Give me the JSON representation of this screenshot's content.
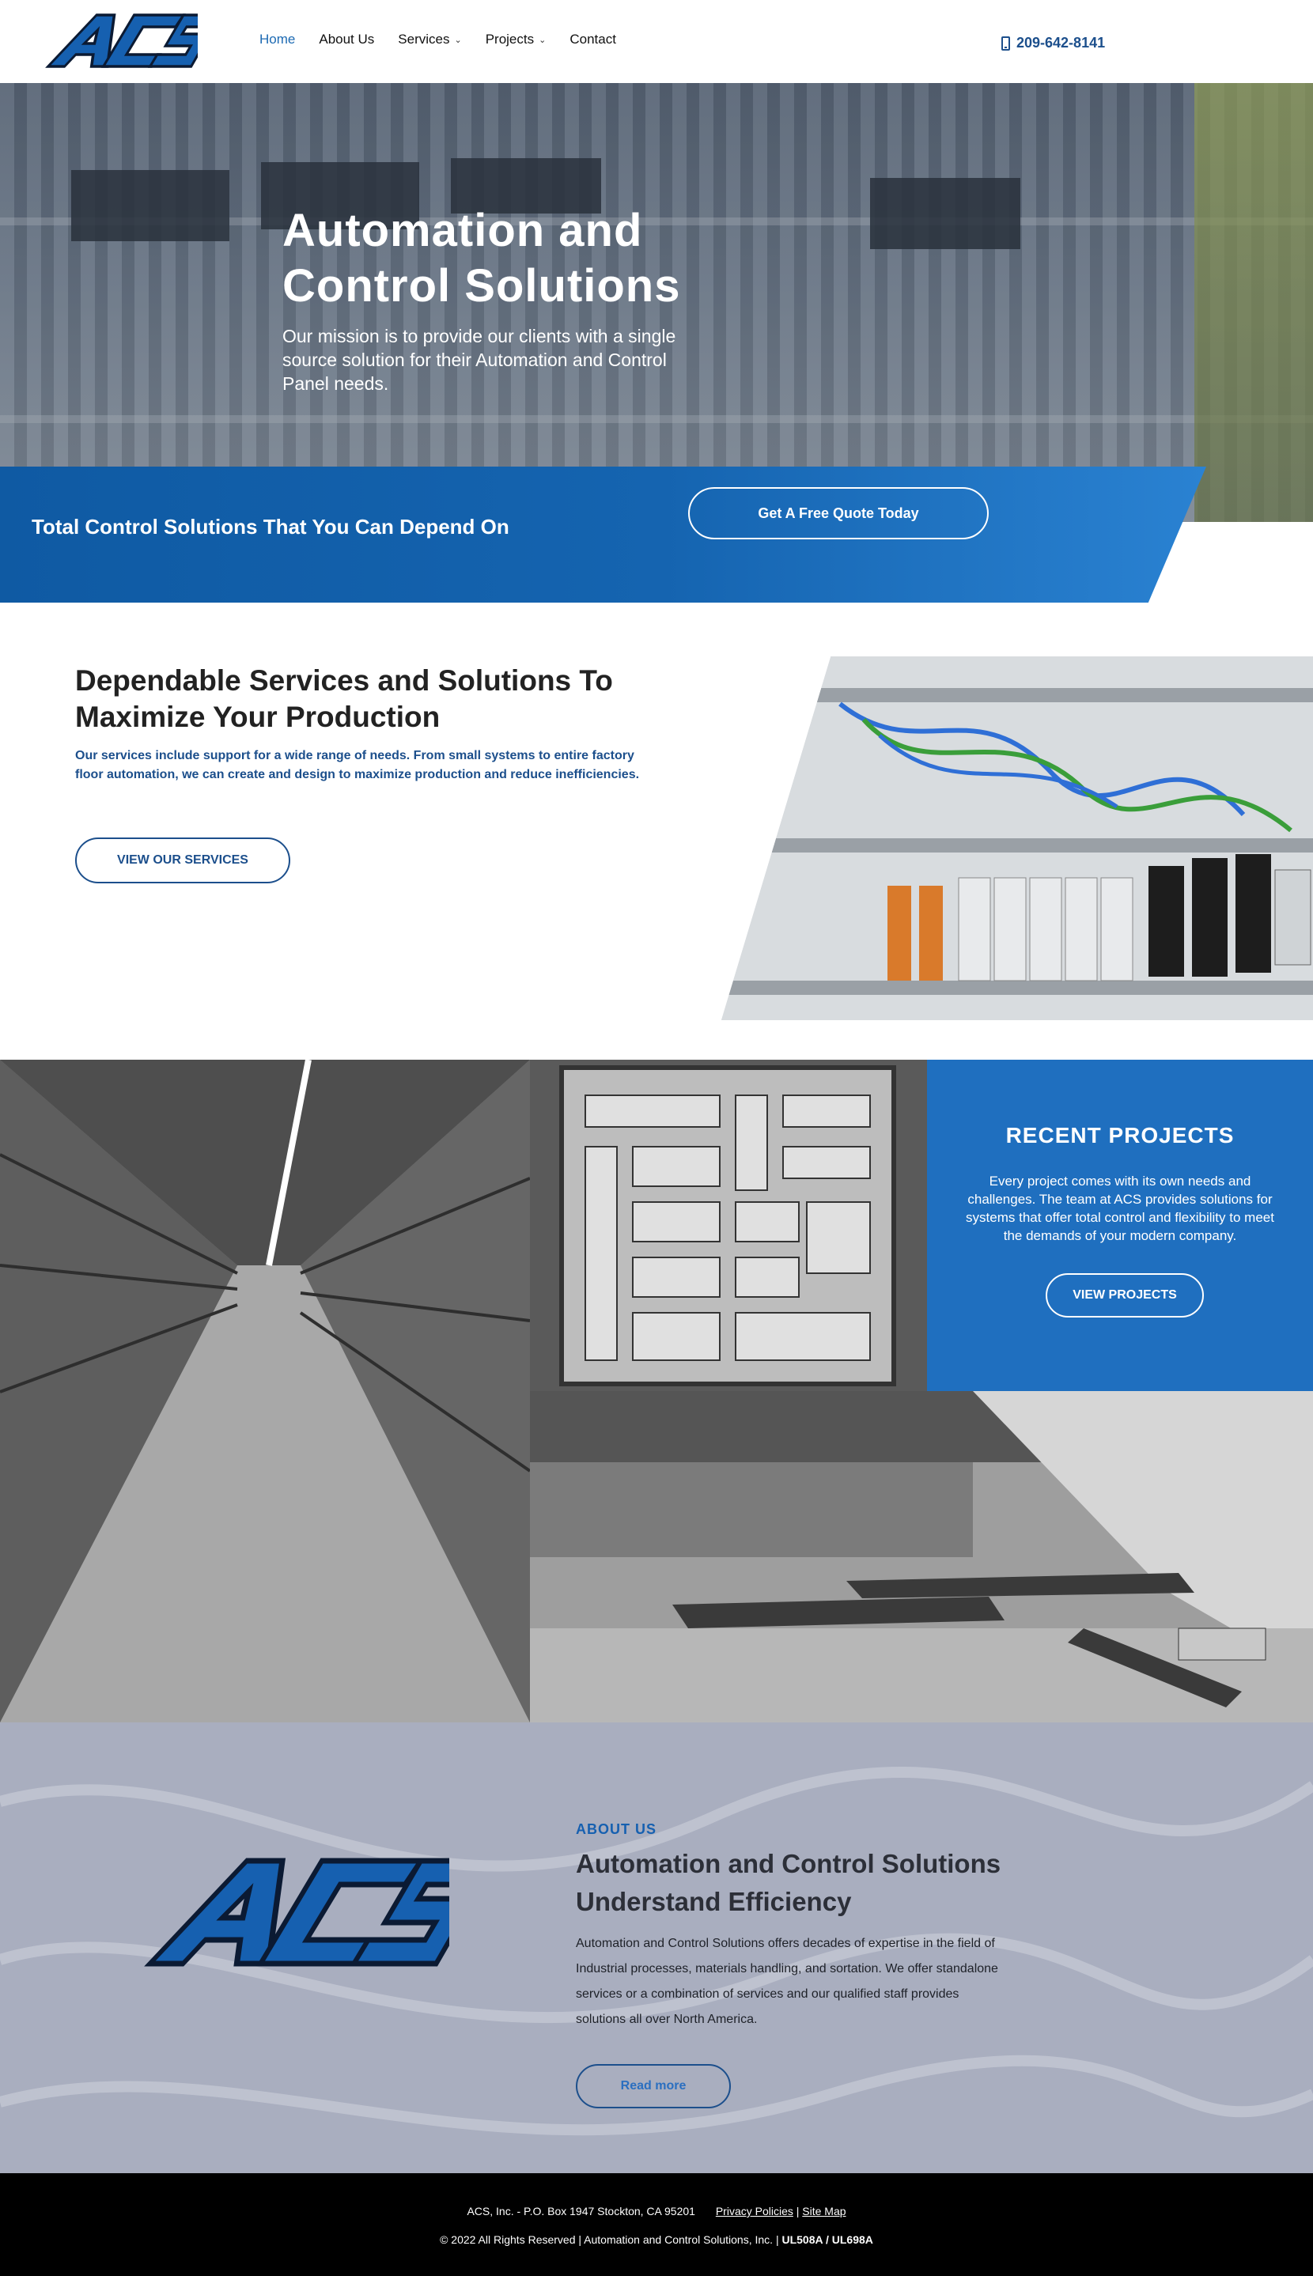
{
  "header": {
    "logo_text": "ACS",
    "nav": [
      {
        "label": "Home",
        "active": true,
        "dropdown": false
      },
      {
        "label": "About Us",
        "active": false,
        "dropdown": false
      },
      {
        "label": "Services",
        "active": false,
        "dropdown": true
      },
      {
        "label": "Projects",
        "active": false,
        "dropdown": true
      },
      {
        "label": "Contact",
        "active": false,
        "dropdown": false
      }
    ],
    "phone": "209-642-8141",
    "phone_icon": "mobile-phone-icon"
  },
  "hero": {
    "title": "Automation and Control Solutions",
    "subtitle": "Our mission is to provide our clients with a single source solution for their Automation and Control Panel needs."
  },
  "banner": {
    "title": "Total Control Solutions That You Can Depend On",
    "button": "Get A Free Quote Today"
  },
  "services": {
    "title": "Dependable Services and Solutions To Maximize Your Production",
    "description": "Our services include support for a wide range of needs. From small systems to entire factory floor automation, we can create and design to maximize production and reduce inefficiencies.",
    "button": "VIEW OUR SERVICES"
  },
  "projects": {
    "title": "RECENT PROJECTS",
    "description": "Every project comes with its own needs and challenges. The team at ACS provides solutions for systems that offer total control and flexibility to meet the demands of your modern company.",
    "button": "VIEW PROJECTS"
  },
  "about": {
    "kicker": "ABOUT US",
    "title": "Automation and Control Solutions Understand Efficiency",
    "description": "Automation and Control Solutions offers decades of expertise in the field of Industrial processes, materials handling, and sortation. We offer standalone services or a combination of services and our qualified staff provides solutions all over North America.",
    "button": "Read more"
  },
  "footer": {
    "address": "ACS, Inc. - P.O. Box 1947 Stockton, CA 95201",
    "privacy": "Privacy Policies",
    "separator": "|",
    "sitemap": "Site Map",
    "copyright": "© 2022 All Rights Reserved | Automation and Control Solutions, Inc. |",
    "certs": "UL508A / UL698A"
  },
  "colors": {
    "brand_blue": "#1c4f8c",
    "accent_blue": "#1f6fbf",
    "nav_active": "#1c6ab3",
    "about_bg": "#a9aebf",
    "footer_bg": "#000000"
  }
}
